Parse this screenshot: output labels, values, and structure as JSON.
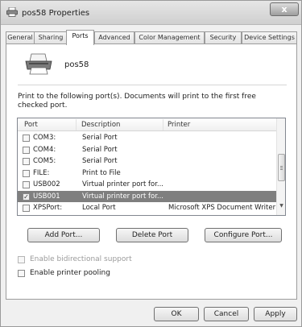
{
  "window": {
    "title": "pos58 Properties",
    "close_label": "x"
  },
  "tabs": [
    {
      "label": "General"
    },
    {
      "label": "Sharing"
    },
    {
      "label": "Ports"
    },
    {
      "label": "Advanced"
    },
    {
      "label": "Color Management"
    },
    {
      "label": "Security"
    },
    {
      "label": "Device Settings"
    }
  ],
  "active_tab": "Ports",
  "printer": {
    "name": "pos58",
    "icon": "printer-icon"
  },
  "instructions": "Print to the following port(s). Documents will print to the first free checked port.",
  "ports_list": {
    "headers": {
      "port": "Port",
      "description": "Description",
      "printer": "Printer"
    },
    "rows": [
      {
        "port": "COM3:",
        "description": "Serial Port",
        "printer": "",
        "checked": false
      },
      {
        "port": "COM4:",
        "description": "Serial Port",
        "printer": "",
        "checked": false
      },
      {
        "port": "COM5:",
        "description": "Serial Port",
        "printer": "",
        "checked": false
      },
      {
        "port": "FILE:",
        "description": "Print to File",
        "printer": "",
        "checked": false
      },
      {
        "port": "USB002",
        "description": "Virtual printer port for...",
        "printer": "",
        "checked": false
      },
      {
        "port": "USB001",
        "description": "Virtual printer port for...",
        "printer": "",
        "checked": true,
        "selected": true
      },
      {
        "port": "XPSPort:",
        "description": "Local Port",
        "printer": "Microsoft XPS Document Writer",
        "checked": false
      }
    ]
  },
  "port_buttons": {
    "add": "Add Port...",
    "delete": "Delete Port",
    "configure": "Configure Port..."
  },
  "options": {
    "bidirectional": {
      "label": "Enable bidirectional support",
      "checked": false,
      "enabled": false
    },
    "pooling": {
      "label": "Enable printer pooling",
      "checked": false,
      "enabled": true
    }
  },
  "dialog_buttons": {
    "ok": "OK",
    "cancel": "Cancel",
    "apply": "Apply"
  },
  "colors": {
    "selected_row": "#7f7f7f",
    "window_bg": "#f0f0f0"
  }
}
